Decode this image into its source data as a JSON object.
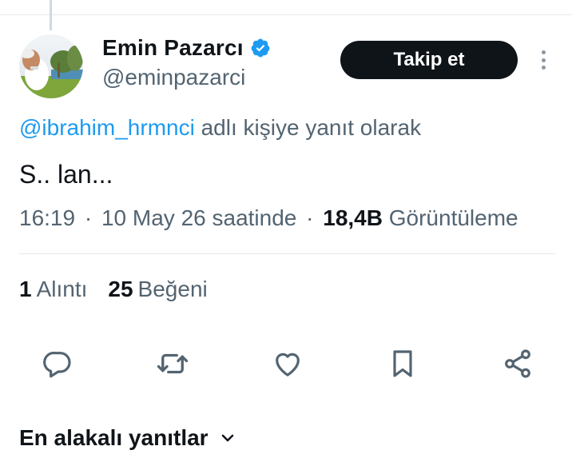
{
  "user": {
    "display_name": "Emin Pazarcı",
    "handle": "@eminpazarci",
    "verified": true,
    "avatar_icon": "profile-photo"
  },
  "follow_button": {
    "label": "Takip et"
  },
  "more_icon": "more-vertical-icon",
  "reply": {
    "mention": "@ibrahim_hrmnci",
    "suffix": " adlı kişiye yanıt olarak"
  },
  "tweet": {
    "text": "S.. lan...",
    "time": "16:19",
    "date_text": "10 May 26 saatinde",
    "views_count": "18,4B",
    "views_label": "Görüntüleme"
  },
  "stats": [
    {
      "count": "1",
      "label": "Alıntı"
    },
    {
      "count": "25",
      "label": "Beğeni"
    }
  ],
  "actions": [
    {
      "name": "reply",
      "icon": "reply-icon"
    },
    {
      "name": "retweet",
      "icon": "retweet-icon"
    },
    {
      "name": "like",
      "icon": "heart-icon"
    },
    {
      "name": "bookmark",
      "icon": "bookmark-icon"
    },
    {
      "name": "share",
      "icon": "share-icon"
    }
  ],
  "replies_sort": {
    "label": "En alakalı yanıtlar",
    "icon": "chevron-down-icon"
  },
  "colors": {
    "text_primary": "#0f1419",
    "text_secondary": "#536471",
    "link": "#1d9bf0",
    "button_bg": "#0f1419",
    "verified": "#1d9bf0"
  }
}
